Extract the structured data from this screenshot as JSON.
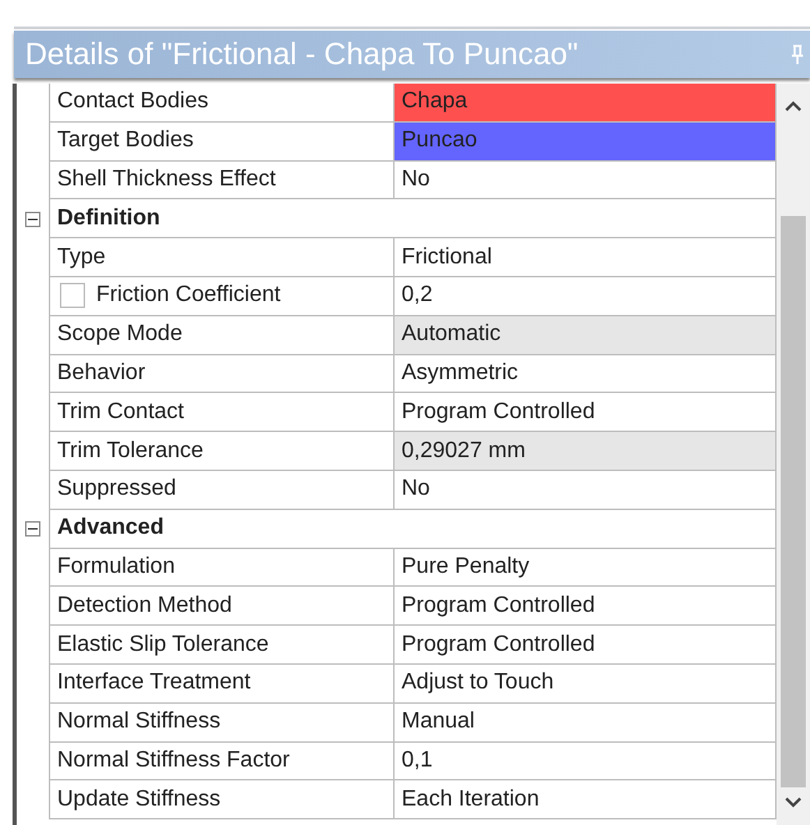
{
  "panel": {
    "title": "Details of \"Frictional - Chapa To Puncao\""
  },
  "rows": [
    {
      "kind": "property",
      "label": "Contact Bodies",
      "value": "Chapa",
      "color": "#ff5050"
    },
    {
      "kind": "property",
      "label": "Target Bodies",
      "value": "Puncao",
      "color": "#6464ff"
    },
    {
      "kind": "property",
      "label": "Shell Thickness Effect",
      "value": "No"
    },
    {
      "kind": "section",
      "label": "Definition",
      "expanded": true
    },
    {
      "kind": "property",
      "label": "Type",
      "value": "Frictional"
    },
    {
      "kind": "checkbox",
      "label": "Friction Coefficient",
      "value": "0,2",
      "checked": false
    },
    {
      "kind": "property",
      "label": "Scope Mode",
      "value": "Automatic",
      "disabled": true
    },
    {
      "kind": "property",
      "label": "Behavior",
      "value": "Asymmetric"
    },
    {
      "kind": "property",
      "label": "Trim Contact",
      "value": "Program Controlled"
    },
    {
      "kind": "property",
      "label": "Trim Tolerance",
      "value": "0,29027 mm",
      "disabled": true
    },
    {
      "kind": "property",
      "label": "Suppressed",
      "value": "No"
    },
    {
      "kind": "section",
      "label": "Advanced",
      "expanded": true
    },
    {
      "kind": "property",
      "label": "Formulation",
      "value": "Pure Penalty"
    },
    {
      "kind": "property",
      "label": "Detection Method",
      "value": "Program Controlled"
    },
    {
      "kind": "property",
      "label": "Elastic Slip Tolerance",
      "value": "Program Controlled"
    },
    {
      "kind": "property",
      "label": "Interface Treatment",
      "value": "Adjust to Touch"
    },
    {
      "kind": "property",
      "label": "Normal Stiffness",
      "value": "Manual"
    },
    {
      "kind": "property",
      "label": "Normal Stiffness Factor",
      "value": "0,1"
    },
    {
      "kind": "property",
      "label": "Update Stiffness",
      "value": "Each Iteration"
    }
  ]
}
